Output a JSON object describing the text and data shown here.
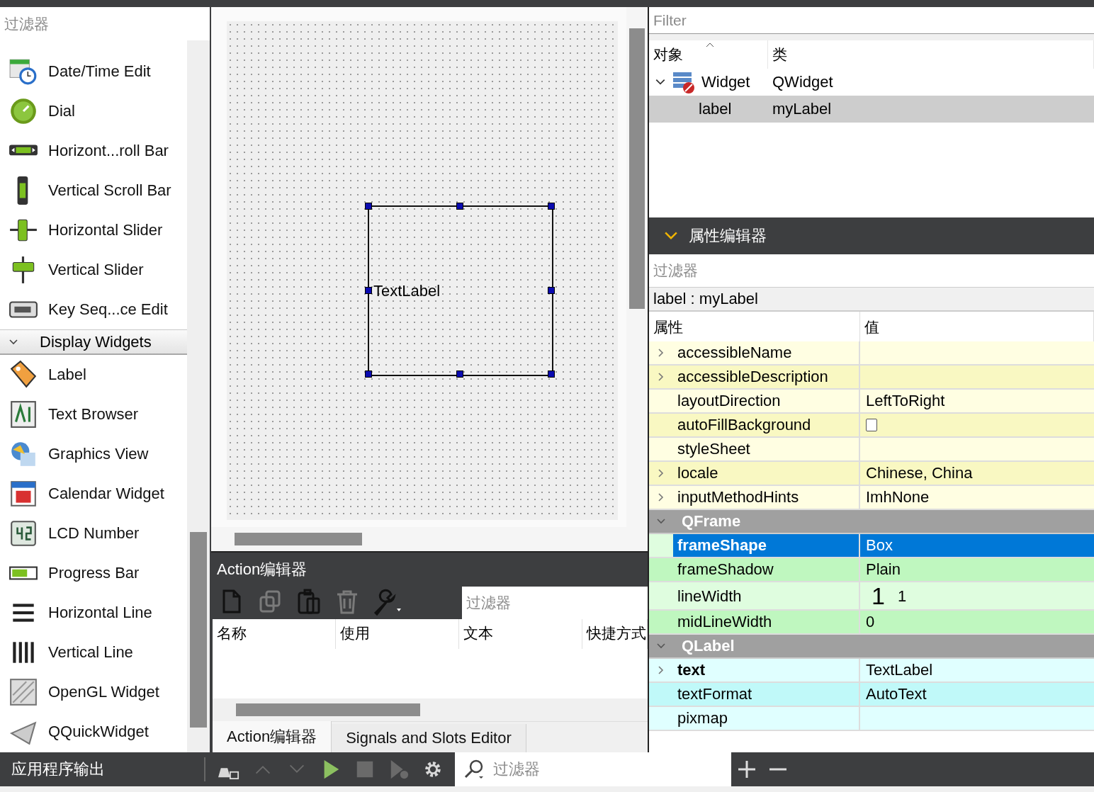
{
  "widget_box": {
    "filter_placeholder": "过滤器",
    "items_before": [
      {
        "label": "Date/Time Edit"
      },
      {
        "label": "Dial"
      },
      {
        "label": "Horizont...roll Bar"
      },
      {
        "label": "Vertical Scroll Bar"
      },
      {
        "label": "Horizontal Slider"
      },
      {
        "label": "Vertical Slider"
      },
      {
        "label": "Key Seq...ce Edit"
      }
    ],
    "category": {
      "label": "Display Widgets",
      "expanded": true
    },
    "items_after": [
      {
        "label": "Label"
      },
      {
        "label": "Text Browser"
      },
      {
        "label": "Graphics View"
      },
      {
        "label": "Calendar Widget"
      },
      {
        "label": "LCD Number"
      },
      {
        "label": "Progress Bar"
      },
      {
        "label": "Horizontal Line"
      },
      {
        "label": "Vertical Line"
      },
      {
        "label": "OpenGL Widget"
      },
      {
        "label": "QQuickWidget"
      }
    ]
  },
  "form": {
    "label_text": "TextLabel"
  },
  "action_editor": {
    "title": "Action编辑器",
    "tools": [
      {
        "disabled": false
      },
      {
        "disabled": true
      },
      {
        "disabled": false
      },
      {
        "disabled": true
      },
      {
        "disabled": false
      }
    ],
    "filter_placeholder": "过滤器",
    "columns": [
      "名称",
      "使用",
      "文本",
      "快捷方式"
    ],
    "tabs": [
      {
        "label": "Action编辑器",
        "selected": true
      },
      {
        "label": "Signals and Slots Editor",
        "selected": false
      }
    ]
  },
  "object_inspector": {
    "filter_placeholder": "Filter",
    "columns": [
      "对象",
      "类"
    ],
    "rows": [
      {
        "object": "Widget",
        "class": "QWidget",
        "expanded": true,
        "selected": false,
        "children": [
          {
            "object": "label",
            "class": "myLabel",
            "selected": true
          }
        ]
      }
    ]
  },
  "property_editor": {
    "title": "属性编辑器",
    "expanded": true,
    "filter_placeholder": "过滤器",
    "object_label": "label : myLabel",
    "columns": [
      "属性",
      "值"
    ],
    "groups": [
      {
        "color": "#fffee2",
        "rows": [
          {
            "name": "accessibleName",
            "value": "",
            "expandable": true,
            "bold": false,
            "selected": false
          },
          {
            "name": "accessibleDescription",
            "value": "",
            "expandable": true,
            "bold": false,
            "selected": false
          },
          {
            "name": "layoutDirection",
            "value": "LeftToRight",
            "expandable": false,
            "bold": false,
            "selected": false
          },
          {
            "name": "autoFillBackground",
            "kind": "checkbox",
            "checked": false,
            "expandable": false,
            "bold": false,
            "selected": false
          },
          {
            "name": "styleSheet",
            "value": "",
            "expandable": false,
            "bold": false,
            "selected": false
          },
          {
            "name": "locale",
            "value": "Chinese, China",
            "expandable": true,
            "bold": false,
            "selected": false
          },
          {
            "name": "inputMethodHints",
            "value": "ImhNone",
            "expandable": true,
            "bold": false,
            "selected": false
          }
        ]
      },
      {
        "header": {
          "name": "QFrame",
          "expanded": true
        },
        "color": "#dffddf",
        "rows": [
          {
            "name": "frameShape",
            "value": "Box",
            "expandable": false,
            "bold": true,
            "selected": true
          },
          {
            "name": "frameShadow",
            "value": "Plain",
            "expandable": false,
            "bold": false,
            "selected": false
          },
          {
            "name": "lineWidth",
            "value": "1",
            "glyph": "1",
            "expandable": false,
            "bold": false,
            "selected": false
          },
          {
            "name": "midLineWidth",
            "value": "0",
            "expandable": false,
            "bold": false,
            "selected": false
          }
        ]
      },
      {
        "header": {
          "name": "QLabel",
          "expanded": true
        },
        "color": "#e0ffff",
        "rows": [
          {
            "name": "text",
            "value": "TextLabel",
            "expandable": true,
            "bold": true,
            "selected": false
          },
          {
            "name": "textFormat",
            "value": "AutoText",
            "expandable": false,
            "bold": false,
            "selected": false
          },
          {
            "name": "pixmap",
            "value": "",
            "expandable": false,
            "bold": false,
            "selected": false
          }
        ]
      }
    ]
  },
  "output_bar": {
    "title": "应用程序输出",
    "tools": [
      {
        "disabled": false
      },
      {
        "disabled": true
      },
      {
        "disabled": true
      },
      {
        "disabled": false
      },
      {
        "disabled": true
      },
      {
        "disabled": true
      },
      {
        "disabled": false
      }
    ],
    "filter_placeholder": "过滤器"
  }
}
